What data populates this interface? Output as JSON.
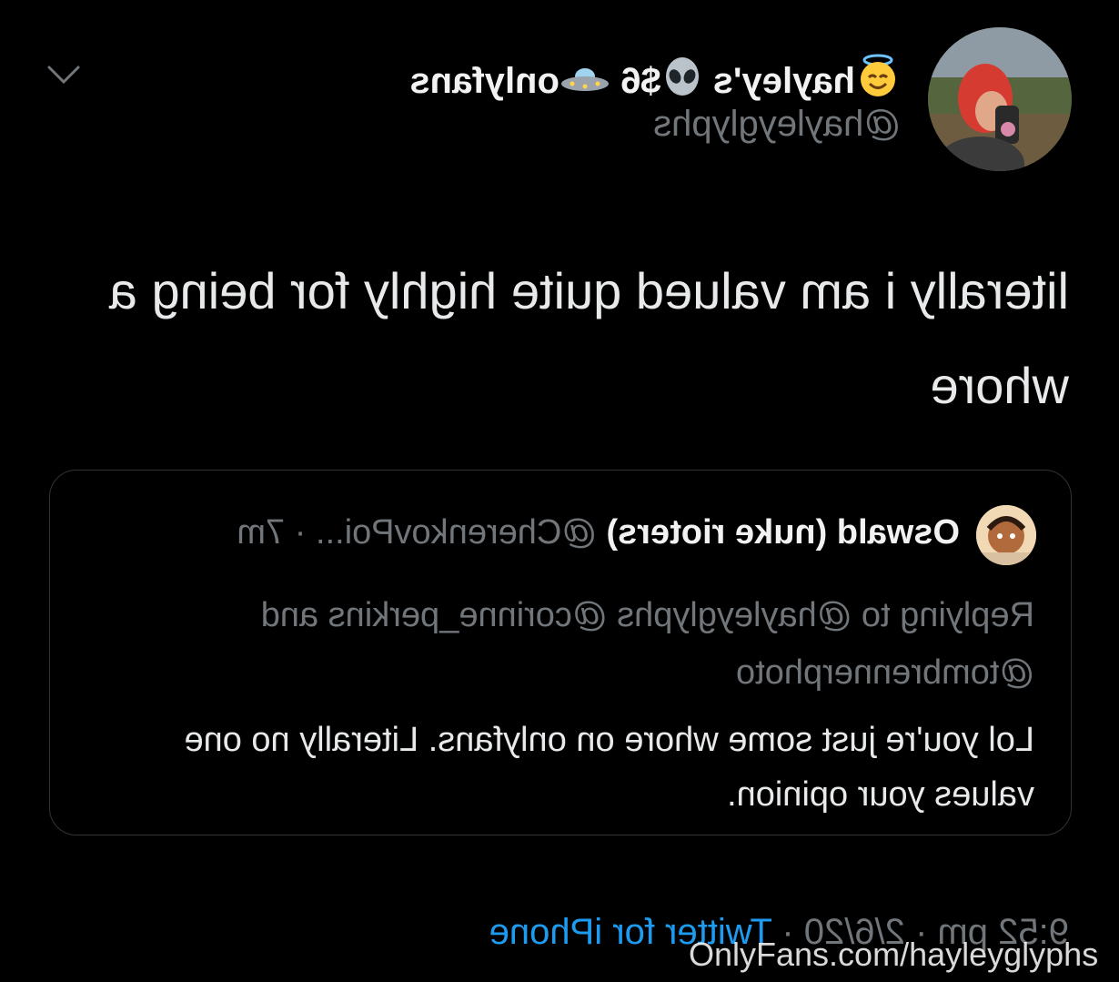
{
  "tweet": {
    "author": {
      "display_name": "hayley's",
      "display_name_suffix": "$6",
      "display_name_tail": "onlyfans",
      "handle": "@hayleyglyphs",
      "emojis": [
        "smiling-face-with-halo",
        "alien",
        "flying-saucer"
      ]
    },
    "text": "literally i am valued quite highly for being a whore",
    "quoted": {
      "display_name": "Oswald (nuke rioters)",
      "handle_time": "@CherenkovPoi... · 7m",
      "reply_context": "Replying to @hayleyglyphs @corinne_perkins and @tombrennerphoto",
      "text": "Lol you're just some whore on onlyfans. Literally no one values your opinion."
    },
    "meta": {
      "time_date": "9:52 pm · 2/6/20 · ",
      "source": "Twitter for iPhone"
    }
  },
  "watermark": "OnlyFans.com/hayleyglyphs",
  "colors": {
    "background": "#000000",
    "text": "#e7e9ea",
    "muted": "#71767b",
    "link": "#1d9bf0",
    "border": "#2f3336"
  }
}
